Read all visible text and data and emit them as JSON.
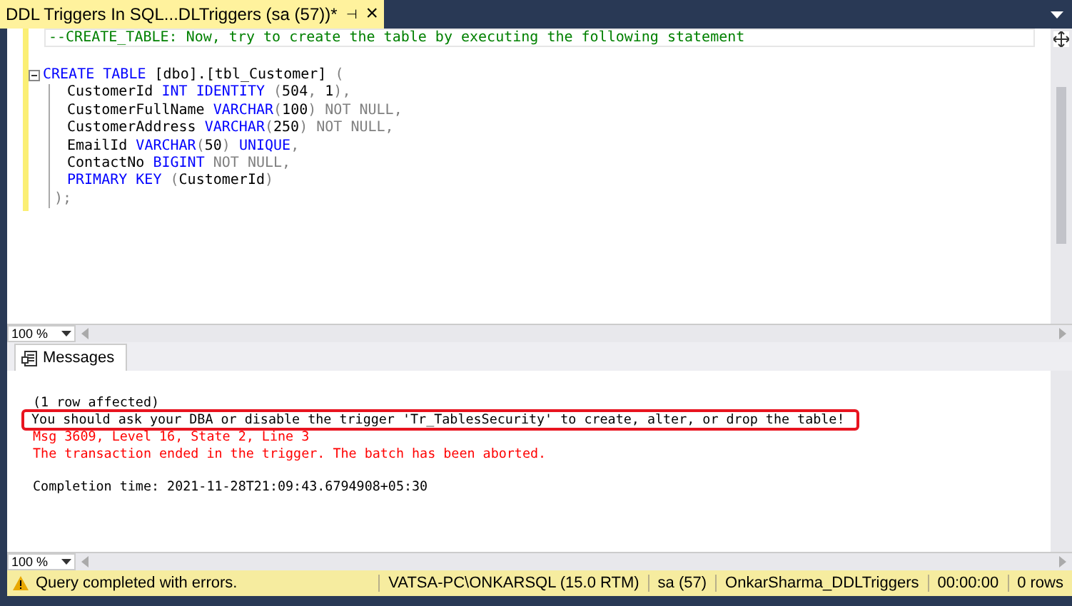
{
  "document_tab": {
    "title": "DDL Triggers In SQL...DLTriggers (sa (57))*",
    "selected": true,
    "pin": "⊣",
    "close": "×"
  },
  "editor": {
    "comment": [
      {
        "kind": "comment",
        "text": "--CREATE_TABLE: Now, try to create the table by executing the following statement"
      }
    ],
    "statement": {
      "header": [
        {
          "kind": "keyword",
          "text": "CREATE TABLE"
        },
        {
          "kind": "plain",
          "text": " [dbo].[tbl_Customer] "
        },
        {
          "kind": "grey",
          "text": "("
        }
      ],
      "children": [
        [
          {
            "kind": "plain",
            "text": "CustomerId "
          },
          {
            "kind": "keyword",
            "text": "INT IDENTITY"
          },
          {
            "kind": "grey",
            "text": " ("
          },
          {
            "kind": "plain",
            "text": "504"
          },
          {
            "kind": "grey",
            "text": ", "
          },
          {
            "kind": "plain",
            "text": "1"
          },
          {
            "kind": "grey",
            "text": "),"
          }
        ],
        [
          {
            "kind": "plain",
            "text": "CustomerFullName "
          },
          {
            "kind": "keyword",
            "text": "VARCHAR"
          },
          {
            "kind": "grey",
            "text": "("
          },
          {
            "kind": "plain",
            "text": "100"
          },
          {
            "kind": "grey",
            "text": ") NOT NULL,"
          }
        ],
        [
          {
            "kind": "plain",
            "text": "CustomerAddress "
          },
          {
            "kind": "keyword",
            "text": "VARCHAR"
          },
          {
            "kind": "grey",
            "text": "("
          },
          {
            "kind": "plain",
            "text": "250"
          },
          {
            "kind": "grey",
            "text": ") NOT NULL,"
          }
        ],
        [
          {
            "kind": "plain",
            "text": "EmailId "
          },
          {
            "kind": "keyword",
            "text": "VARCHAR"
          },
          {
            "kind": "grey",
            "text": "("
          },
          {
            "kind": "plain",
            "text": "50"
          },
          {
            "kind": "grey",
            "text": ") "
          },
          {
            "kind": "keyword",
            "text": "UNIQUE"
          },
          {
            "kind": "grey",
            "text": ","
          }
        ],
        [
          {
            "kind": "plain",
            "text": "ContactNo "
          },
          {
            "kind": "keyword",
            "text": "BIGINT"
          },
          {
            "kind": "grey",
            "text": " NOT NULL,"
          }
        ],
        [
          {
            "kind": "keyword",
            "text": "PRIMARY KEY"
          },
          {
            "kind": "grey",
            "text": " ("
          },
          {
            "kind": "plain",
            "text": "CustomerId"
          },
          {
            "kind": "grey",
            "text": ")"
          }
        ]
      ],
      "footer": [
        {
          "kind": "grey",
          "text": ");"
        }
      ],
      "expanded": true
    },
    "zoom": "100 %"
  },
  "results_tab": {
    "label": "Messages"
  },
  "messages": [
    {
      "kind": "info",
      "text": "(1 row affected)",
      "boxed": false
    },
    {
      "kind": "info",
      "text": "You should ask your DBA or disable the trigger 'Tr_TablesSecurity' to create, alter, or drop the table!",
      "boxed": true
    },
    {
      "kind": "error",
      "text": "Msg 3609, Level 16, State 2, Line 3",
      "boxed": false
    },
    {
      "kind": "error",
      "text": "The transaction ended in the trigger. The batch has been aborted.",
      "boxed": false
    }
  ],
  "completion_time": "Completion time: 2021-11-28T21:09:43.6794908+05:30",
  "results_zoom": "100 %",
  "status_bar": {
    "warning": true,
    "message": "Query completed with errors.",
    "segments": [
      "VATSA-PC\\ONKARSQL (15.0 RTM)",
      "sa (57)",
      "OnkarSharma_DDLTriggers",
      "00:00:00",
      "0 rows"
    ]
  }
}
